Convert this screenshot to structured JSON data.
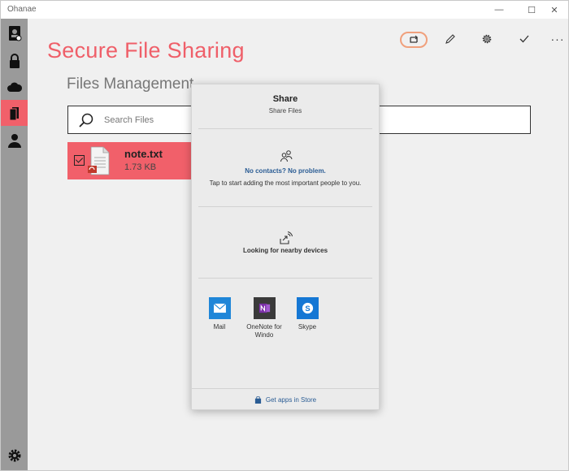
{
  "window": {
    "title": "Ohanae",
    "minimize_glyph": "—",
    "maximize_glyph": "☐",
    "close_glyph": "✕"
  },
  "sidebar": {
    "items": [
      {
        "icon": "user-badge-icon"
      },
      {
        "icon": "lock-icon"
      },
      {
        "icon": "cloud-icon"
      },
      {
        "icon": "document-icon",
        "active": true
      },
      {
        "icon": "person-icon"
      }
    ],
    "bottom_icon": "gear-icon"
  },
  "header": {
    "app_title": "Secure File Sharing",
    "section_title": "Files Management"
  },
  "toolbar": {
    "items": [
      "share-icon",
      "pencil-icon",
      "gear-icon",
      "checkmark-icon",
      "more-icon"
    ],
    "more_glyph": "···"
  },
  "search": {
    "placeholder": "Search Files",
    "value": ""
  },
  "files": [
    {
      "name": "note.txt",
      "size": "1.73 KB",
      "selected": true
    }
  ],
  "share_panel": {
    "title": "Share",
    "subtitle": "Share Files",
    "no_contacts": "No contacts? No problem.",
    "tap_text": "Tap to start adding the most important people to you.",
    "nearby": "Looking for nearby devices",
    "apps": [
      {
        "label": "Mail",
        "icon": "mail-icon"
      },
      {
        "label": "OneNote for Windo",
        "icon": "onenote-icon"
      },
      {
        "label": "Skype",
        "icon": "skype-icon"
      }
    ],
    "store_link": "Get apps in Store"
  },
  "colors": {
    "accent": "#f1606a",
    "sidebar": "#9a9a9a",
    "link": "#2a5c94",
    "highlight_ring": "#f0a07c"
  }
}
